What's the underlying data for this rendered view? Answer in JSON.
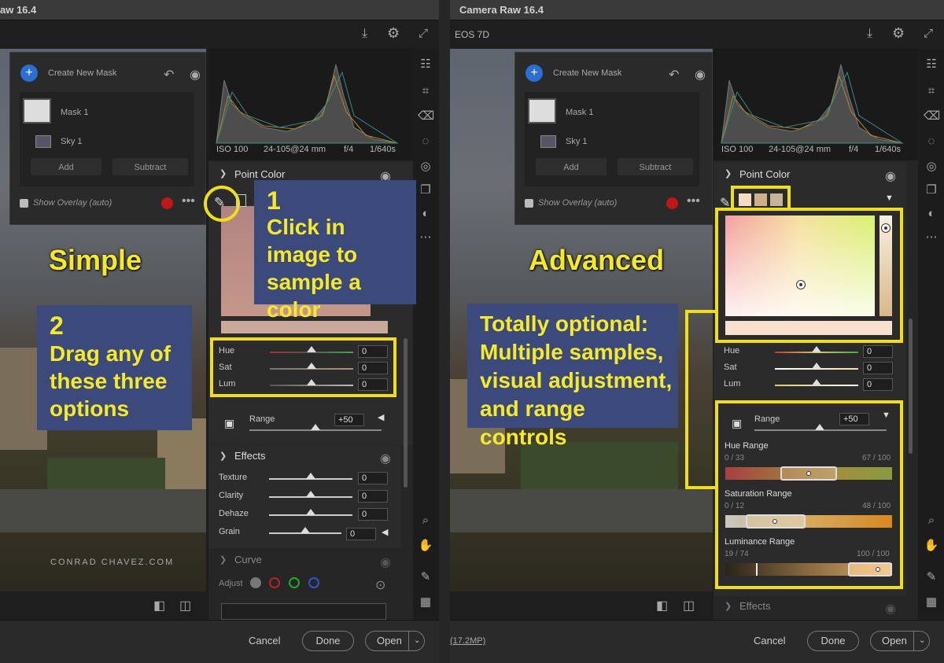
{
  "left": {
    "title": "aw 16.4",
    "mask": {
      "create_label": "Create New Mask",
      "items": [
        "Mask 1",
        "Sky 1"
      ],
      "add_label": "Add",
      "subtract_label": "Subtract",
      "overlay_label": "Show Overlay (auto)"
    },
    "exif": {
      "iso": "ISO 100",
      "lens": "24-105@24 mm",
      "aperture": "f/4",
      "shutter": "1/640s"
    },
    "point_color": {
      "header": "Point Color",
      "sliders": [
        {
          "label": "Hue",
          "value": "0"
        },
        {
          "label": "Sat",
          "value": "0"
        },
        {
          "label": "Lum",
          "value": "0"
        }
      ],
      "range_label": "Range",
      "range_value": "+50"
    },
    "effects": {
      "header": "Effects",
      "sliders": [
        {
          "label": "Texture",
          "value": "0"
        },
        {
          "label": "Clarity",
          "value": "0"
        },
        {
          "label": "Dehaze",
          "value": "0"
        },
        {
          "label": "Grain",
          "value": "0"
        }
      ]
    },
    "curve": {
      "header": "Curve",
      "adjust_label": "Adjust"
    },
    "credit": "CONRAD CHAVEZ.COM",
    "buttons": {
      "cancel": "Cancel",
      "done": "Done",
      "open": "Open"
    },
    "annotations": {
      "heading": "Simple",
      "step1_num": "1",
      "step1_text": "Click in image to sample a color",
      "step2_num": "2",
      "step2_text": "Drag any of these three options"
    }
  },
  "right": {
    "title": "Camera Raw 16.4",
    "camera": "EOS 7D",
    "mask": {
      "create_label": "Create New Mask",
      "items": [
        "Mask 1",
        "Sky 1"
      ],
      "add_label": "Add",
      "subtract_label": "Subtract",
      "overlay_label": "Show Overlay (auto)"
    },
    "exif": {
      "iso": "ISO 100",
      "lens": "24-105@24 mm",
      "aperture": "f/4",
      "shutter": "1/640s"
    },
    "point_color": {
      "header": "Point Color",
      "sliders": [
        {
          "label": "Hue",
          "value": "0"
        },
        {
          "label": "Sat",
          "value": "0"
        },
        {
          "label": "Lum",
          "value": "0"
        }
      ],
      "range_label": "Range",
      "range_value": "+50",
      "hue_range": {
        "label": "Hue Range",
        "left": "0 / 33",
        "right": "67 / 100"
      },
      "sat_range": {
        "label": "Saturation Range",
        "left": "0 / 12",
        "right": "48 / 100"
      },
      "lum_range": {
        "label": "Luminance Range",
        "left": "19 / 74",
        "right": "100 / 100"
      }
    },
    "effects_header": "Effects",
    "file_info": "(17.2MP)",
    "buttons": {
      "cancel": "Cancel",
      "done": "Done",
      "open": "Open"
    },
    "annotations": {
      "heading": "Advanced",
      "optional_text": "Totally optional: Multiple samples, visual adjustment, and range controls"
    }
  },
  "colors": {
    "callout_bg": "#3b4a7a",
    "callout_text": "#f5e92c",
    "highlight": "#f0dd1c",
    "swatches": [
      "#f3dcc0",
      "#cdb087",
      "#c7b597"
    ]
  }
}
